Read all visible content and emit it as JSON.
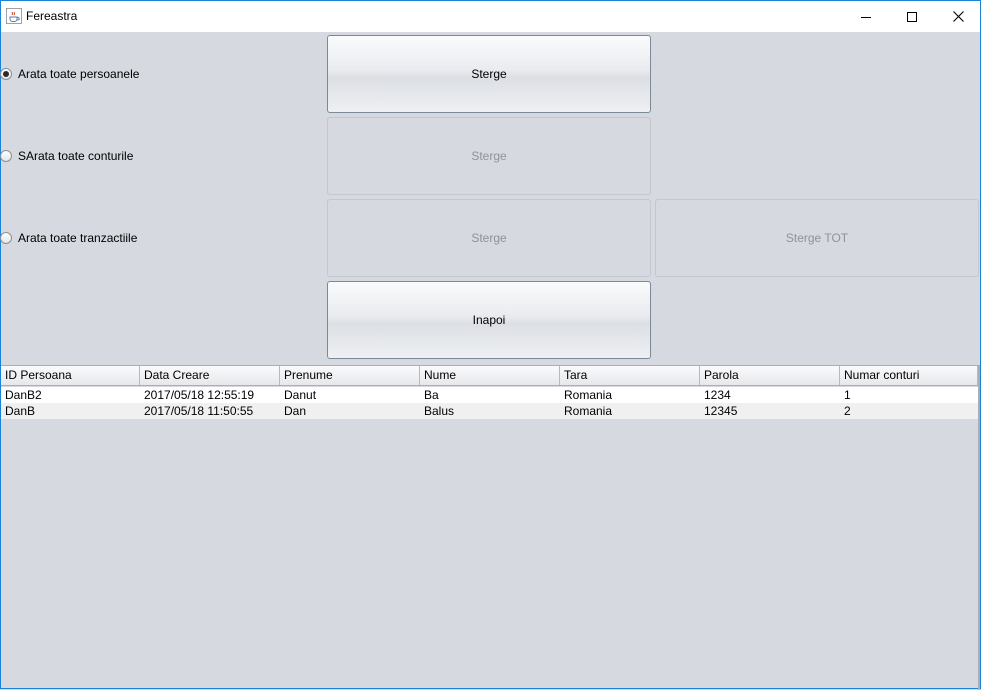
{
  "window": {
    "title": "Fereastra",
    "icons": {
      "app": "java-cup-icon",
      "minimize": "minimize-icon",
      "maximize": "maximize-icon",
      "close": "close-icon"
    }
  },
  "options": [
    {
      "label": "Arata toate persoanele",
      "selected": true
    },
    {
      "label": "SArata toate conturile",
      "selected": false
    },
    {
      "label": "Arata toate tranzactiile",
      "selected": false
    }
  ],
  "buttons": {
    "sterge_persoane": {
      "label": "Sterge",
      "enabled": true
    },
    "sterge_conturi": {
      "label": "Sterge",
      "enabled": false
    },
    "sterge_tranzactii": {
      "label": "Sterge",
      "enabled": false
    },
    "sterge_tot": {
      "label": "Sterge TOT",
      "enabled": false
    },
    "inapoi": {
      "label": "Inapoi",
      "enabled": true
    }
  },
  "table": {
    "columns": [
      "ID Persoana",
      "Data Creare",
      "Prenume",
      "Nume",
      "Tara",
      "Parola",
      "Numar conturi"
    ],
    "rows": [
      [
        "DanB2",
        "2017/05/18 12:55:19",
        "Danut",
        "Ba",
        "Romania",
        "1234",
        "1"
      ],
      [
        "DanB",
        "2017/05/18 11:50:55",
        "Dan",
        "Balus",
        "Romania",
        "12345",
        "2"
      ]
    ]
  },
  "colors": {
    "accent_border": "#1883d7",
    "background": "#d6d9df",
    "disabled_text": "#8e939a"
  }
}
